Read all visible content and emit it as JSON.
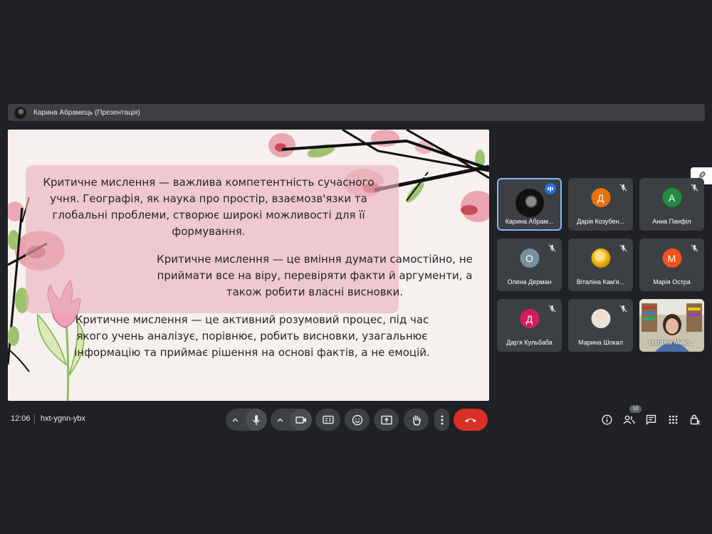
{
  "presentation": {
    "title": "Карина Абрамець (Презентація)"
  },
  "slide": {
    "text1": "Критичне мислення — важлива компетентність сучасного учня. Географія, як наука про простір, взаємозв'язки та глобальні проблеми, створює широкі можливості для її формування.",
    "text2": "Критичне мислення — це вміння думати самостійно, не приймати все на віру, перевіряти факти й аргументи, а також робити власні висновки.",
    "text3": "Критичне мислення — це активний розумовий процес, під час якого учень аналізує, порівнює, робить висновки, узагальнює інформацію та приймає рішення на основі фактів, а не емоцій."
  },
  "participants": [
    {
      "name": "Карина Абрам...",
      "initial": "",
      "color": "#4a4a4a",
      "muted": false,
      "speaking": true
    },
    {
      "name": "Дарія Козубен...",
      "initial": "Д",
      "color": "#e8710a",
      "muted": true
    },
    {
      "name": "Анна Панфіл",
      "initial": "А",
      "color": "#1e8e3e",
      "muted": true
    },
    {
      "name": "Олена Дерман",
      "initial": "О",
      "color": "#78909c",
      "muted": true
    },
    {
      "name": "Віталіна Кам'я...",
      "initial": "",
      "color": "#f9ab00",
      "muted": true
    },
    {
      "name": "Марія Остра",
      "initial": "М",
      "color": "#f4511e",
      "muted": true
    },
    {
      "name": "Дар'я Кульбаба",
      "initial": "Д",
      "color": "#d81b60",
      "muted": true
    },
    {
      "name": "Марина Шокал",
      "initial": "",
      "color": "#f1e7df",
      "muted": true
    },
    {
      "name": "Наталія Мико...",
      "initial": "",
      "color": "#7b8a70",
      "muted": false
    }
  ],
  "meeting": {
    "time": "12:06",
    "code": "hxt-ygnn-ybx",
    "participant_count": "10"
  },
  "colors": {
    "background": "#202124",
    "tile": "#3c4043",
    "end_call": "#d93025",
    "active_border": "#8ab4f8"
  }
}
